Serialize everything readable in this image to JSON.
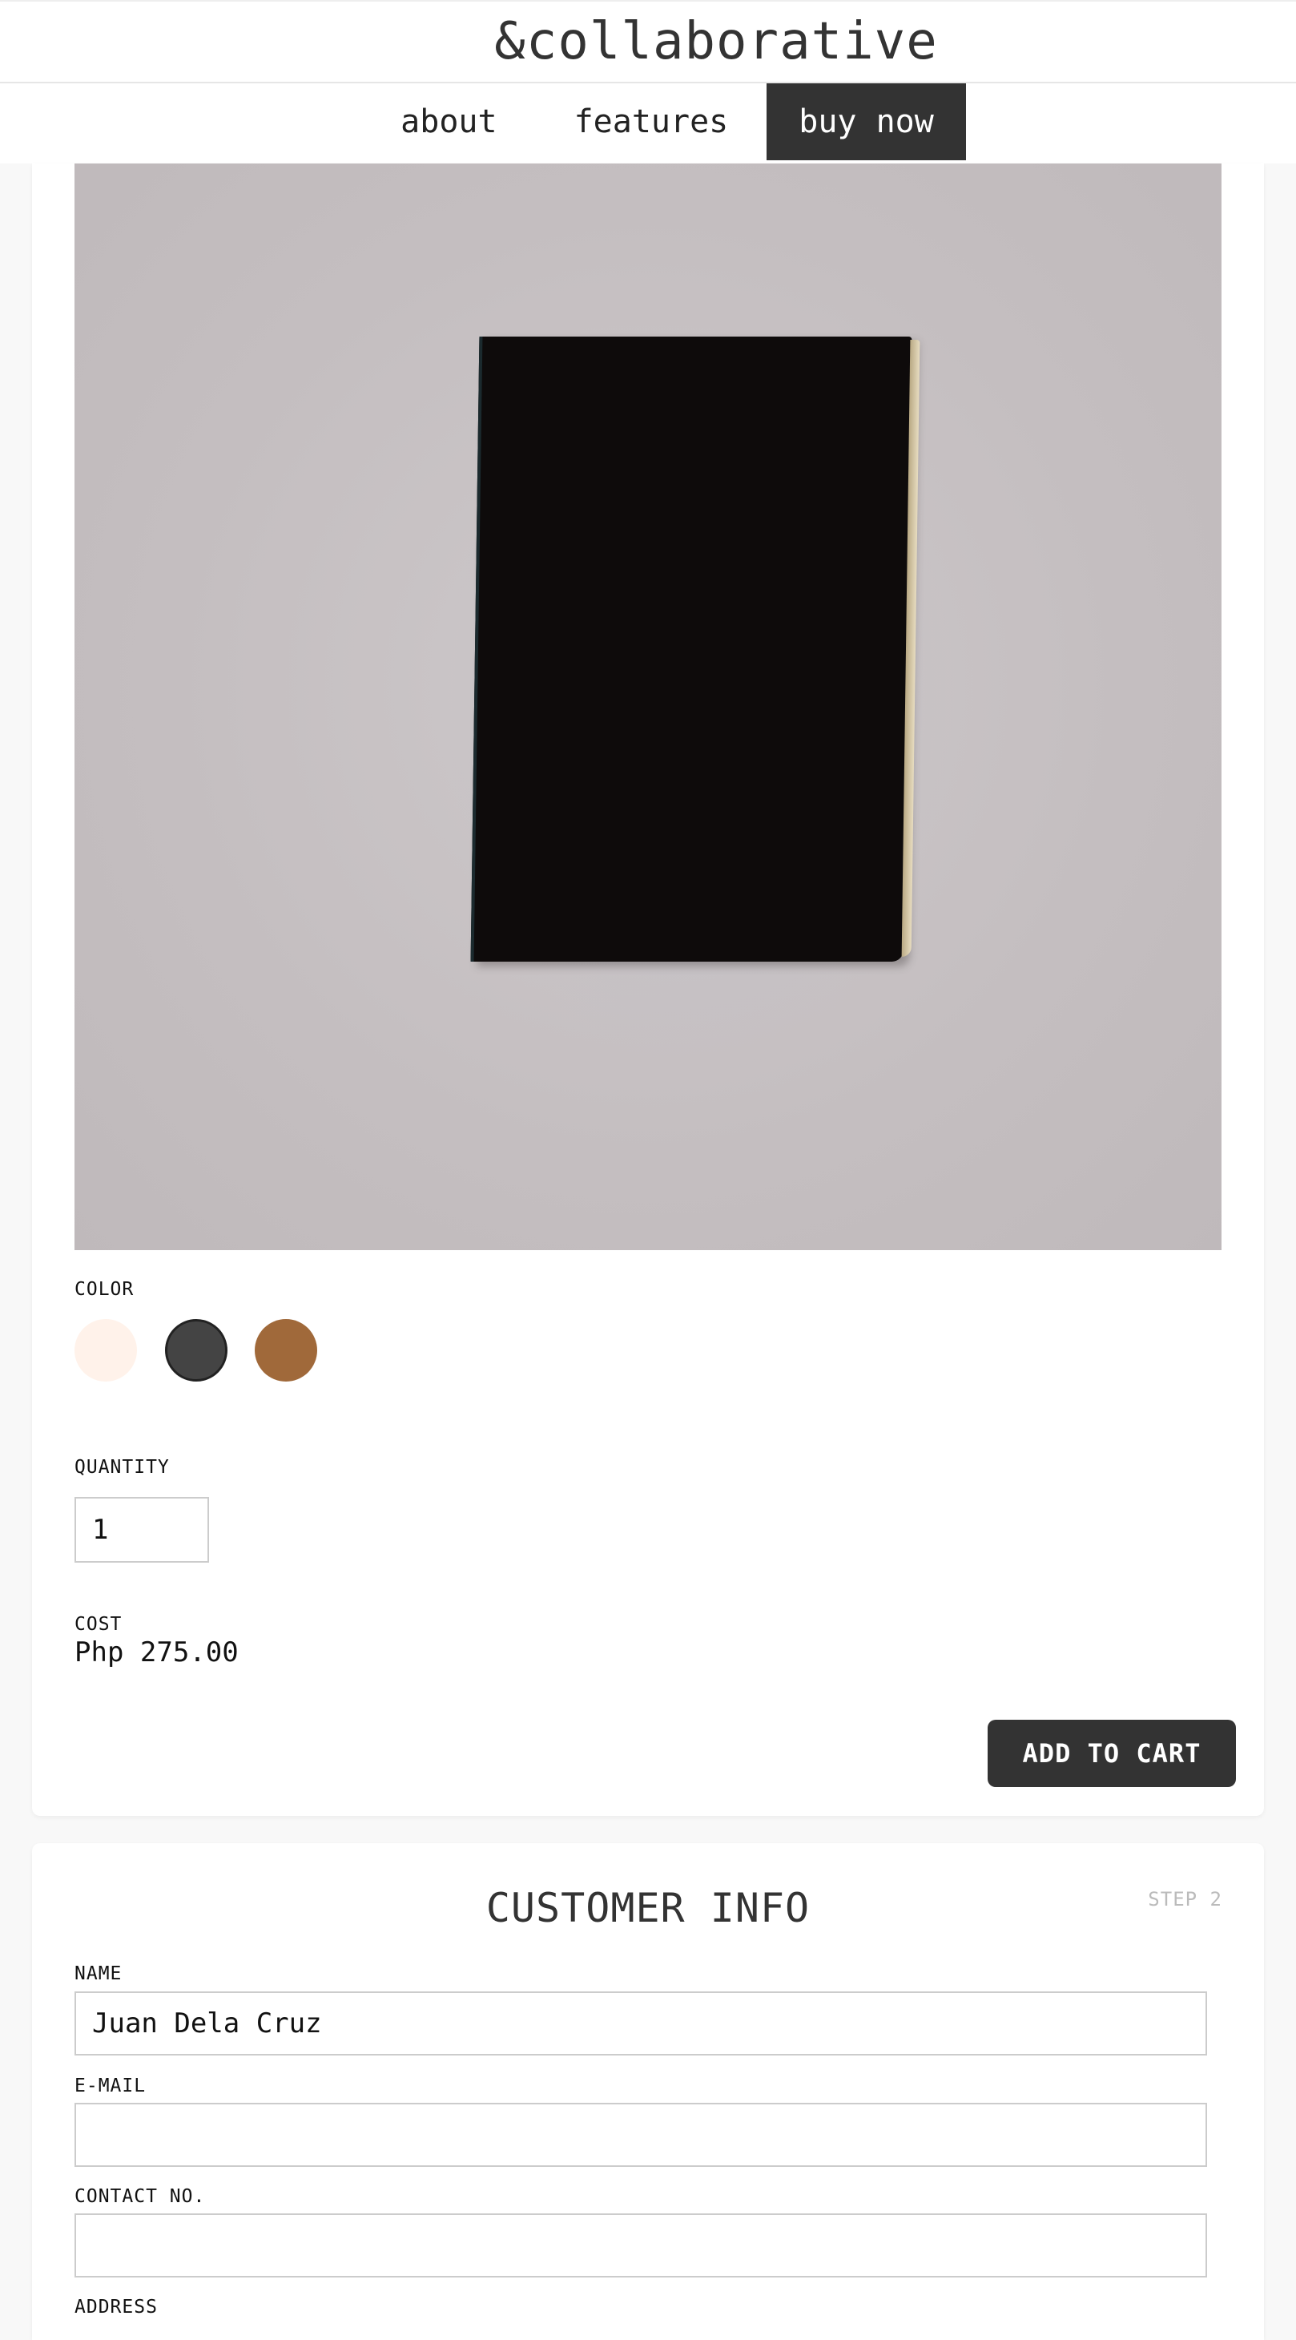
{
  "header": {
    "brand": "&collaborative"
  },
  "nav": {
    "items": [
      {
        "label": "about",
        "active": false
      },
      {
        "label": "features",
        "active": false
      },
      {
        "label": "buy now",
        "active": true
      }
    ]
  },
  "product": {
    "color_label": "COLOR",
    "colors": [
      "#fff2ea",
      "#444444",
      "#a0693a"
    ],
    "selected_color_index": 1,
    "quantity_label": "QUANTITY",
    "quantity_value": "1",
    "cost_label": "COST",
    "cost_value": "Php 275.00",
    "add_to_cart_label": "ADD TO CART"
  },
  "customer_info": {
    "title": "CUSTOMER INFO",
    "step": "STEP 2",
    "name_label": "NAME",
    "name_value": "Juan Dela Cruz",
    "email_label": "E-MAIL",
    "email_value": "",
    "contact_label": "CONTACT NO.",
    "contact_value": "",
    "address_label": "ADDRESS"
  }
}
